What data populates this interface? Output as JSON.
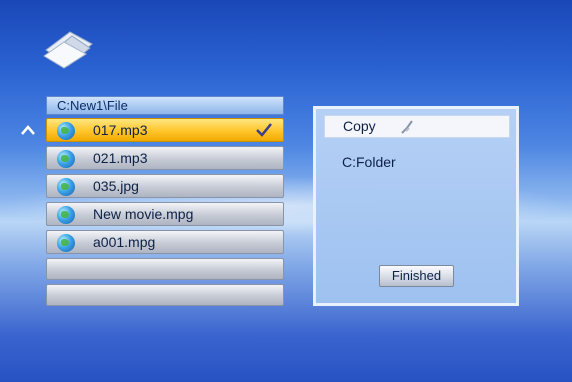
{
  "current_path": "C:New1\\File",
  "files": [
    {
      "name": "017.mp3",
      "selected": true,
      "checked": true
    },
    {
      "name": "021.mp3",
      "selected": false,
      "checked": false
    },
    {
      "name": "035.jpg",
      "selected": false,
      "checked": false
    },
    {
      "name": "New movie.mpg",
      "selected": false,
      "checked": false
    },
    {
      "name": "a001.mpg",
      "selected": false,
      "checked": false
    }
  ],
  "action_panel": {
    "action": "Copy",
    "destination": "C:Folder",
    "finished_label": "Finished"
  },
  "icons": {
    "logo": "folder-icon",
    "scroll": "chevron-up-icon",
    "file_type": "globe-icon",
    "check": "checkmark-icon",
    "cursor": "cursor-icon"
  },
  "colors": {
    "selected_row": "#ffc52b",
    "background": "#2a62d2"
  }
}
